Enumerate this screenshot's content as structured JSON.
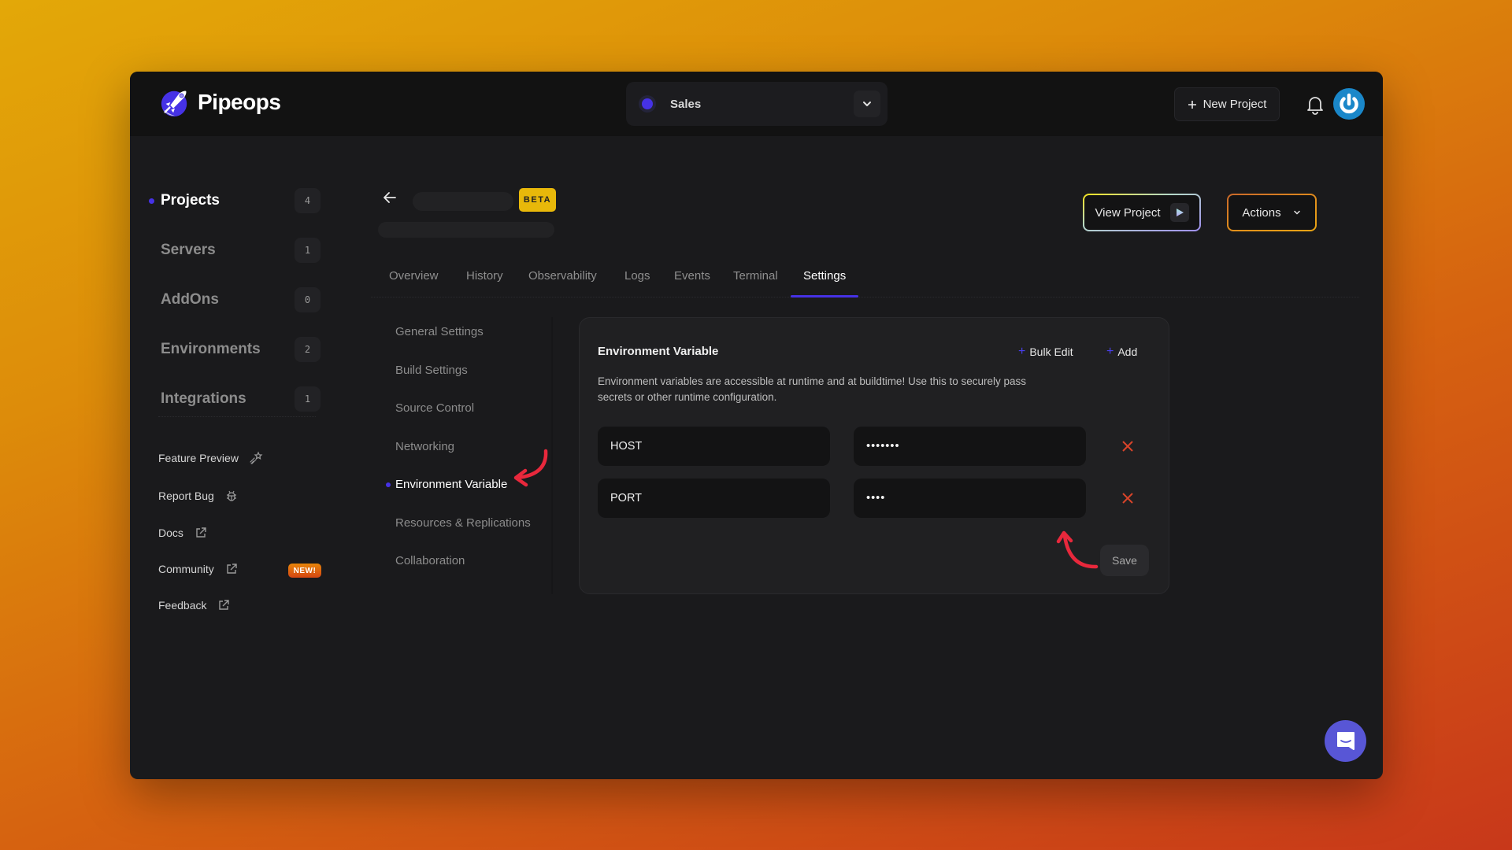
{
  "brand": {
    "name": "Pipeops",
    "accent": "#4632e6"
  },
  "header": {
    "workspace": {
      "label": "Sales",
      "icon": "chevron-down-icon"
    },
    "new_project_label": "New Project",
    "notifications_icon": "bell-icon",
    "avatar_icon": "power-icon"
  },
  "sidebar": {
    "items": [
      {
        "label": "Projects",
        "count": "4",
        "active": true
      },
      {
        "label": "Servers",
        "count": "1"
      },
      {
        "label": "AddOns",
        "count": "0"
      },
      {
        "label": "Environments",
        "count": "2"
      },
      {
        "label": "Integrations",
        "count": "1"
      }
    ],
    "links": [
      {
        "label": "Feature Preview",
        "icon": "shooting-star-icon"
      },
      {
        "label": "Report Bug",
        "icon": "bug-icon"
      },
      {
        "label": "Docs",
        "icon": "external-link-icon"
      },
      {
        "label": "Community",
        "icon": "external-link-icon",
        "badge": "NEW!"
      },
      {
        "label": "Feedback",
        "icon": "external-link-icon"
      }
    ]
  },
  "project": {
    "badge": "BETA",
    "view_project_label": "View Project",
    "actions_label": "Actions"
  },
  "tabs": [
    {
      "label": "Overview"
    },
    {
      "label": "History"
    },
    {
      "label": "Observability"
    },
    {
      "label": "Logs"
    },
    {
      "label": "Events"
    },
    {
      "label": "Terminal"
    },
    {
      "label": "Settings",
      "active": true
    }
  ],
  "settings_nav": [
    {
      "label": "General Settings"
    },
    {
      "label": "Build Settings"
    },
    {
      "label": "Source Control"
    },
    {
      "label": "Networking"
    },
    {
      "label": "Environment Variable",
      "active": true
    },
    {
      "label": "Resources & Replications"
    },
    {
      "label": "Collaboration"
    }
  ],
  "env_card": {
    "title": "Environment Variable",
    "bulk_edit_label": "Bulk Edit",
    "add_label": "Add",
    "description": "Environment variables are accessible at runtime and at buildtime! Use this to securely pass secrets or other runtime configuration.",
    "variables": [
      {
        "key": "HOST",
        "value": "•••••••"
      },
      {
        "key": "PORT",
        "value": "••••"
      }
    ],
    "save_label": "Save"
  },
  "annotation_color": "#e8283c"
}
